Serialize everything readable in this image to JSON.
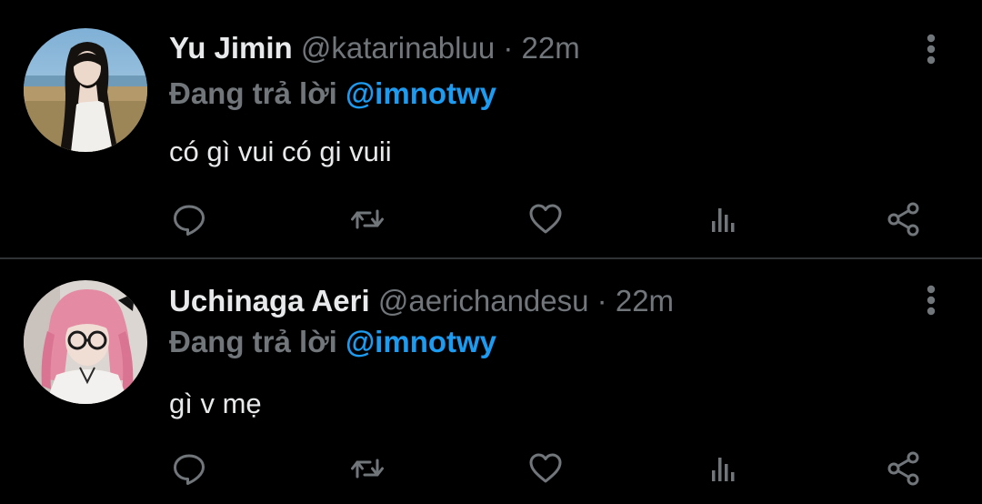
{
  "colors": {
    "background": "#000000",
    "primary_text": "#e7e9ea",
    "secondary_text": "#71767b",
    "accent": "#1d9bf0",
    "divider": "#2f3336"
  },
  "icons": [
    "more-vertical-icon",
    "reply-icon",
    "retweet-icon",
    "like-icon",
    "views-icon",
    "share-icon"
  ],
  "tweets": [
    {
      "display_name": "Yu Jimin",
      "handle": "@katarinabluu",
      "separator": "·",
      "time": "22m",
      "reply_prefix": "Đang trả lời",
      "reply_to": "@imnotwy",
      "text": "có gì vui có gi vuii"
    },
    {
      "display_name": "Uchinaga Aeri",
      "handle": "@aerichandesu",
      "separator": "·",
      "time": "22m",
      "reply_prefix": "Đang trả lời",
      "reply_to": "@imnotwy",
      "text": "gì v mẹ"
    }
  ]
}
